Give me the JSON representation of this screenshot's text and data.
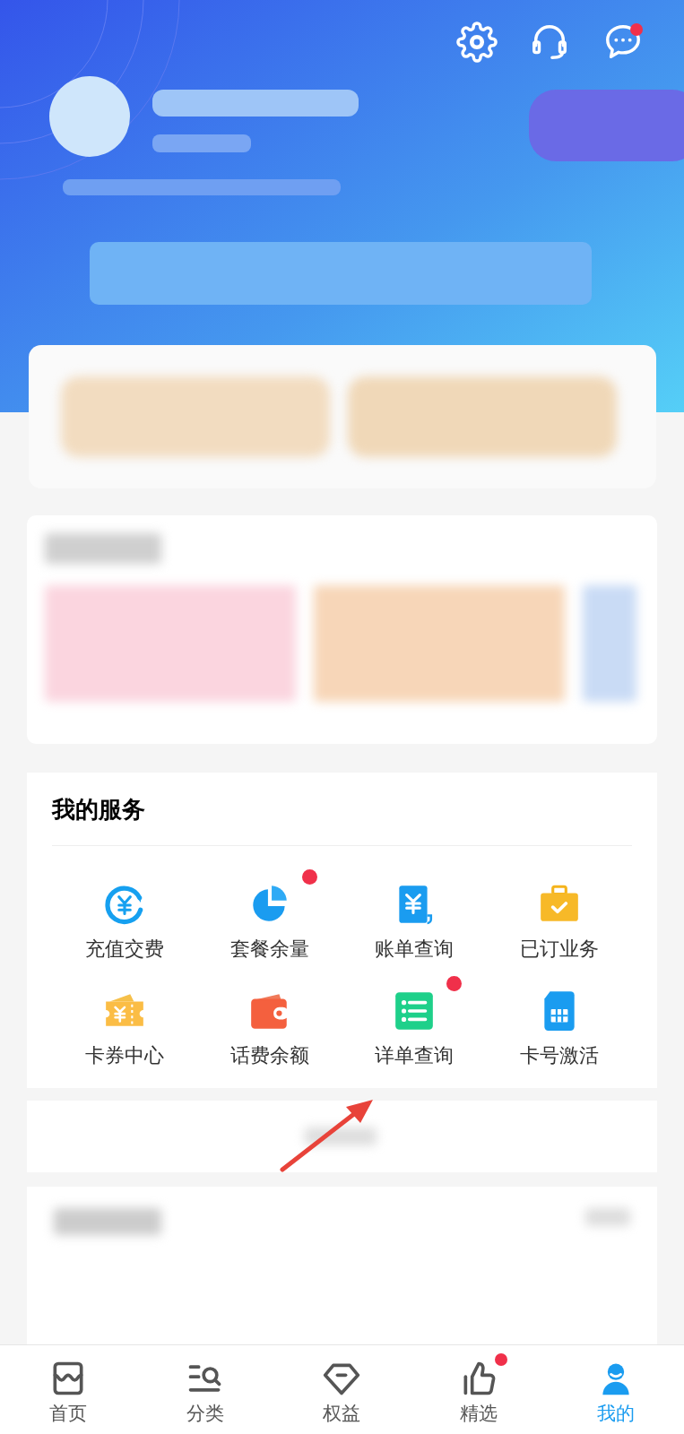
{
  "header": {
    "actions": [
      {
        "kind": "settings",
        "badge": false
      },
      {
        "kind": "support",
        "badge": false
      },
      {
        "kind": "messages",
        "badge": true
      }
    ]
  },
  "services": {
    "title": "我的服务",
    "items": [
      {
        "label": "充值交费",
        "badge": false
      },
      {
        "label": "套餐余量",
        "badge": true
      },
      {
        "label": "账单查询",
        "badge": false
      },
      {
        "label": "已订业务",
        "badge": false
      },
      {
        "label": "卡券中心",
        "badge": false
      },
      {
        "label": "话费余额",
        "badge": false
      },
      {
        "label": "详单查询",
        "badge": true
      },
      {
        "label": "卡号激活",
        "badge": false
      }
    ]
  },
  "tab_bar": [
    {
      "label": "首页",
      "selected": false,
      "badge": false
    },
    {
      "label": "分类",
      "selected": false,
      "badge": false
    },
    {
      "label": "权益",
      "selected": false,
      "badge": false
    },
    {
      "label": "精选",
      "selected": false,
      "badge": true
    },
    {
      "label": "我的",
      "selected": true,
      "badge": false
    }
  ]
}
